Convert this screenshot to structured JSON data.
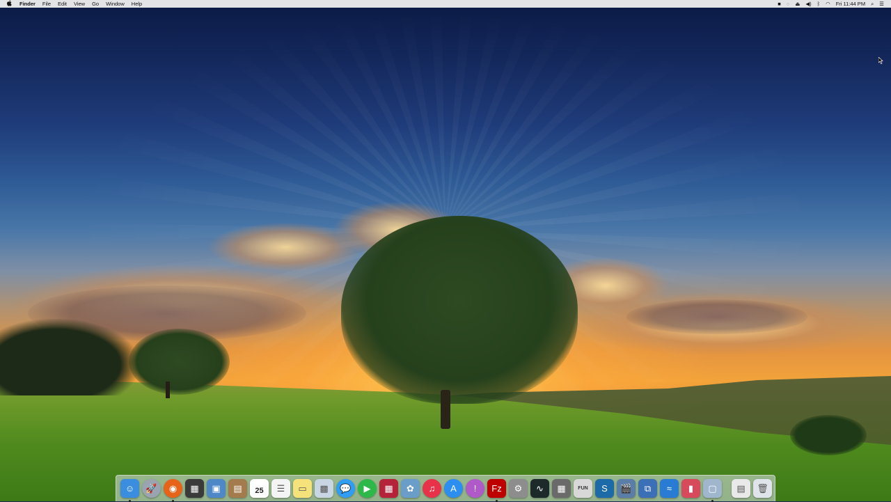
{
  "menubar": {
    "apple": "",
    "menus": [
      "Finder",
      "File",
      "Edit",
      "View",
      "Go",
      "Window",
      "Help"
    ],
    "clock": "Fri 11:44 PM",
    "status_icons": [
      "camera-icon",
      "circle-icon",
      "eject-icon",
      "volume-icon",
      "bluetooth-icon",
      "wifi-icon",
      "spotlight-icon",
      "notification-center-icon"
    ]
  },
  "dock": {
    "apps": [
      {
        "name": "finder",
        "icon": "finder-icon",
        "bg": "#3b8de0",
        "glyph": "☺",
        "running": true
      },
      {
        "name": "launchpad",
        "icon": "launchpad-icon",
        "bg": "#9aa4b0",
        "glyph": "🚀",
        "running": false
      },
      {
        "name": "firefox",
        "icon": "firefox-icon",
        "bg": "#e8631a",
        "glyph": "◉",
        "running": true
      },
      {
        "name": "mission-control",
        "icon": "mission-control-icon",
        "bg": "#3a3a3a",
        "glyph": "▦",
        "running": false
      },
      {
        "name": "preview",
        "icon": "preview-icon",
        "bg": "#4f88c6",
        "glyph": "▣",
        "running": false
      },
      {
        "name": "contacts",
        "icon": "contacts-icon",
        "bg": "#a37b4c",
        "glyph": "▤",
        "running": false
      },
      {
        "name": "calendar",
        "icon": "calendar-icon",
        "bg": "#ffffff",
        "glyph": "25",
        "running": false
      },
      {
        "name": "reminders",
        "icon": "reminders-icon",
        "bg": "#f4f4f4",
        "glyph": "☰",
        "running": false
      },
      {
        "name": "notes",
        "icon": "notes-icon",
        "bg": "#f6e27a",
        "glyph": "▭",
        "running": false
      },
      {
        "name": "photo-booth",
        "icon": "photo-booth-icon",
        "bg": "#c8d6e4",
        "glyph": "▩",
        "running": false
      },
      {
        "name": "messages",
        "icon": "messages-icon",
        "bg": "#2f9df4",
        "glyph": "💬",
        "running": false
      },
      {
        "name": "facetime",
        "icon": "facetime-icon",
        "bg": "#2fb84a",
        "glyph": "▶",
        "running": false
      },
      {
        "name": "photo-strip",
        "icon": "photo-strip-icon",
        "bg": "#b5233a",
        "glyph": "▦",
        "running": false
      },
      {
        "name": "iphoto",
        "icon": "iphoto-icon",
        "bg": "#6a9ec9",
        "glyph": "✿",
        "running": false
      },
      {
        "name": "itunes",
        "icon": "itunes-icon",
        "bg": "#e8324a",
        "glyph": "♫",
        "running": false
      },
      {
        "name": "app-store",
        "icon": "app-store-icon",
        "bg": "#2b8ef0",
        "glyph": "A",
        "running": false
      },
      {
        "name": "ibooks",
        "icon": "ibooks-icon",
        "bg": "#b05ac9",
        "glyph": "!",
        "running": false
      },
      {
        "name": "filezilla",
        "icon": "filezilla-icon",
        "bg": "#bf0000",
        "glyph": "Fz",
        "running": true
      },
      {
        "name": "system-preferences",
        "icon": "system-preferences-icon",
        "bg": "#8d8d8d",
        "glyph": "⚙",
        "running": false
      },
      {
        "name": "activity-monitor",
        "icon": "activity-monitor-icon",
        "bg": "#1e2a2a",
        "glyph": "∿",
        "running": false
      },
      {
        "name": "calculator",
        "icon": "calculator-icon",
        "bg": "#6a6a6a",
        "glyph": "▦",
        "running": false
      },
      {
        "name": "fun-app",
        "icon": "fun-app-icon",
        "bg": "#d8d8d8",
        "glyph": "FUN",
        "running": false
      },
      {
        "name": "scrivener",
        "icon": "scrivener-icon",
        "bg": "#1d6aa8",
        "glyph": "S",
        "running": false
      },
      {
        "name": "imovie",
        "icon": "imovie-icon",
        "bg": "#5a7ea8",
        "glyph": "🎬",
        "running": false
      },
      {
        "name": "utility-app",
        "icon": "utility-app-icon",
        "bg": "#3b6fb6",
        "glyph": "⧉",
        "running": false
      },
      {
        "name": "wunderlist",
        "icon": "wunderlist-icon",
        "bg": "#2a7bd4",
        "glyph": "≈",
        "running": false
      },
      {
        "name": "papers",
        "icon": "papers-icon",
        "bg": "#d64a5c",
        "glyph": "▮",
        "running": false
      },
      {
        "name": "image-capture",
        "icon": "image-capture-icon",
        "bg": "#9fb6cc",
        "glyph": "▢",
        "running": true
      }
    ],
    "stacks": [
      {
        "name": "downloads-stack",
        "icon": "downloads-stack-icon",
        "bg": "#e9e9e9",
        "glyph": "▤"
      },
      {
        "name": "trash",
        "icon": "trash-icon",
        "bg": "#dfe4ea",
        "glyph": "🗑"
      }
    ]
  }
}
